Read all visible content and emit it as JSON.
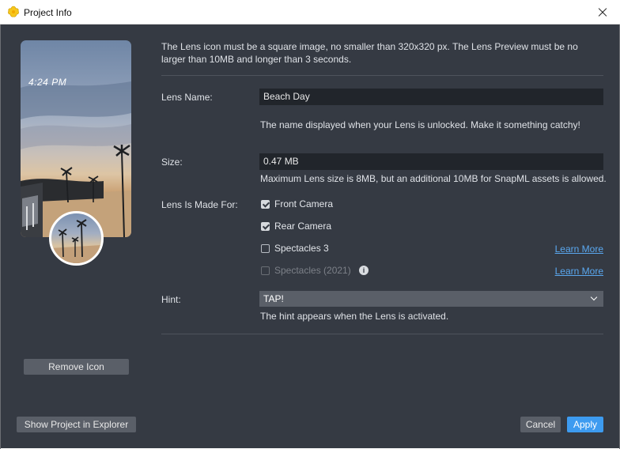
{
  "window": {
    "title": "Project Info"
  },
  "preview": {
    "time": "4:24 PM"
  },
  "description": "The Lens icon must be a square image, no smaller than 320x320 px. The Lens Preview must be no larger than 10MB and longer than 3 seconds.",
  "lens_name": {
    "label": "Lens Name:",
    "value": "Beach Day",
    "help": "The name displayed when your Lens is unlocked. Make it something catchy!"
  },
  "size": {
    "label": "Size:",
    "value": "0.47 MB",
    "help": "Maximum Lens size is 8MB, but an additional 10MB for SnapML assets is allowed."
  },
  "made_for": {
    "label": "Lens Is Made For:",
    "options": [
      {
        "label": "Front Camera",
        "checked": true
      },
      {
        "label": "Rear Camera",
        "checked": true
      },
      {
        "label": "Spectacles 3",
        "checked": false,
        "link": "Learn More"
      },
      {
        "label": "Spectacles (2021)",
        "checked": false,
        "disabled": true,
        "link": "Learn More"
      }
    ]
  },
  "hint": {
    "label": "Hint:",
    "value": "TAP!",
    "help": "The hint appears when the Lens is activated."
  },
  "buttons": {
    "remove_icon": "Remove Icon",
    "show_in_explorer": "Show Project in Explorer",
    "cancel": "Cancel",
    "apply": "Apply"
  },
  "colors": {
    "accent": "#3d9bf0",
    "link": "#5aa8f0",
    "background": "#353a43"
  }
}
